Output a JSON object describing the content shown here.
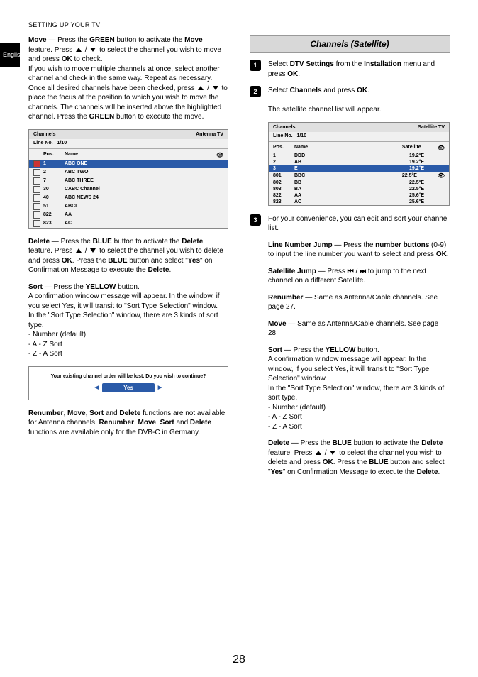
{
  "header": "SETTING UP YOUR TV",
  "lang": "English",
  "pageNum": "28",
  "left": {
    "move1a": "Move",
    "move1b": " — Press the ",
    "move1c": "GREEN",
    "move1d": " button to activate the ",
    "move1e": "Move",
    "move1f": " feature. Press ",
    "move1g": " / ",
    "move1h": " to select the channel you wish to move and press ",
    "move1i": "OK",
    "move1j": " to check.",
    "move2": "If you wish to move multiple channels at once, select another channel and check in the same way. Repeat as necessary.",
    "move3a": "Once all desired channels have been checked, press ",
    "move3b": " / ",
    "move3c": " to place the focus at the position to which you wish to move the channels. The channels will be inserted above the highlighted channel. Press the ",
    "move3d": "GREEN",
    "move3e": " button to execute the move.",
    "tv1": {
      "title": "Channels",
      "type": "Antenna TV",
      "line": "Line No.",
      "lineV": "1/10",
      "hPos": "Pos.",
      "hName": "Name",
      "rows": [
        [
          "1",
          "ABC ONE",
          true,
          true
        ],
        [
          "2",
          "ABC TWO",
          false,
          false
        ],
        [
          "7",
          "ABC THREE",
          false,
          false
        ],
        [
          "30",
          "CABC Channel",
          false,
          false
        ],
        [
          "40",
          "ABC NEWS 24",
          false,
          false
        ],
        [
          "51",
          "ABCI",
          false,
          false
        ],
        [
          "822",
          "AA",
          false,
          false
        ],
        [
          "823",
          "AC",
          false,
          false
        ]
      ]
    },
    "del1a": "Delete",
    "del1b": " — Press the ",
    "del1c": "BLUE",
    "del1d": " button to activate the ",
    "del1e": "Delete",
    "del1f": " feature. Press ",
    "del1g": " / ",
    "del1h": " to select the channel you wish to delete and press ",
    "del1i": "OK",
    "del1j": ". Press the ",
    "del1k": "BLUE",
    "del1l": " button and select \"",
    "del1m": "Yes",
    "del1n": "\" on Confirmation Message to execute the ",
    "del1o": "Delete",
    "del1p": ".",
    "sort1a": "Sort",
    "sort1b": " — Press the ",
    "sort1c": "YELLOW",
    "sort1d": " button.",
    "sort2": "A confirmation window message will appear. In the window, if you select Yes, it will transit to \"Sort Type Selection\" window.",
    "sort3": "In the \"Sort Type Selection\" window, there are 3 kinds of sort type.",
    "sort4": "- Number (default)",
    "sort5": "- A - Z Sort",
    "sort6": "- Z - A Sort",
    "conf": {
      "txt": "Your existing channel order will be lost. Do you wish to continue?",
      "btn": "Yes"
    },
    "note1a": "Renumber",
    "note1b": ", ",
    "note1c": "Move",
    "note1d": ", ",
    "note1e": "Sort",
    "note1f": " and ",
    "note1g": "Delete",
    "note1h": " functions are not available for Antenna channels. ",
    "note1i": "Renumber",
    "note1j": ", ",
    "note1k": "Move",
    "note1l": ", ",
    "note1m": "Sort",
    "note1n": " and ",
    "note1o": "Delete",
    "note1p": " functions are available only for the DVB-C in Germany."
  },
  "right": {
    "title": "Channels (Satellite)",
    "s1a": "Select ",
    "s1b": "DTV Settings",
    "s1c": " from the ",
    "s1d": "Installation",
    "s1e": " menu and press ",
    "s1f": "OK",
    "s1g": ".",
    "s2a": "Select ",
    "s2b": "Channels",
    "s2c": " and press ",
    "s2d": "OK",
    "s2e": ".",
    "s2f": "The satellite channel list will appear.",
    "tv2": {
      "title": "Channels",
      "type": "Satellite TV",
      "line": "Line No.",
      "lineV": "1/10",
      "hPos": "Pos.",
      "hName": "Name",
      "hSat": "Satellite",
      "rows": [
        [
          "1",
          "DDD",
          "19.2°E",
          false,
          false
        ],
        [
          "2",
          "AB",
          "19.2°E",
          false,
          false
        ],
        [
          "3",
          "E",
          "19.2°E",
          true,
          false
        ],
        [
          "801",
          "BBC",
          "22.5°E",
          false,
          true
        ],
        [
          "802",
          "BB",
          "22.5°E",
          false,
          false
        ],
        [
          "803",
          "BA",
          "22.5°E",
          false,
          false
        ],
        [
          "822",
          "AA",
          "25.6°E",
          false,
          false
        ],
        [
          "823",
          "AC",
          "25.6°E",
          false,
          false
        ]
      ]
    },
    "s3": "For your convenience, you can edit and sort your channel list.",
    "lj1a": "Line Number Jump",
    "lj1b": " — Press the ",
    "lj1c": "number buttons",
    "lj1d": " (0-9) to input the line number you want to select and press ",
    "lj1e": "OK",
    "lj1f": ".",
    "sj1a": "Satellite Jump",
    "sj1b": " — Press ",
    "sj1c": " / ",
    "sj1d": " to jump to the next channel on a different Satellite.",
    "rn1a": "Renumber",
    "rn1b": " — Same as Antenna/Cable channels. See page 27.",
    "mv1a": "Move",
    "mv1b": " — Same as Antenna/Cable channels. See page 28.",
    "so1a": "Sort",
    "so1b": " — Press the ",
    "so1c": "YELLOW",
    "so1d": " button.",
    "so2": "A confirmation window message will appear. In the window, if you select Yes, it will transit to \"Sort Type Selection\" window.",
    "so3": "In the \"Sort Type Selection\" window, there are 3 kinds of sort type.",
    "so4": "- Number (default)",
    "so5": "- A - Z Sort",
    "so6": "- Z - A Sort",
    "de1a": "Delete",
    "de1b": " — Press the ",
    "de1c": "BLUE",
    "de1d": " button to activate the ",
    "de1e": "Delete",
    "de1f": " feature. Press ",
    "de1g": " / ",
    "de1h": " to select the channel you wish to delete and press ",
    "de1i": "OK",
    "de1j": ". Press the ",
    "de1k": "BLUE",
    "de1l": " button and select \"",
    "de1m": "Yes",
    "de1n": "\" on Confirmation Message to execute the ",
    "de1o": "Delete",
    "de1p": "."
  }
}
